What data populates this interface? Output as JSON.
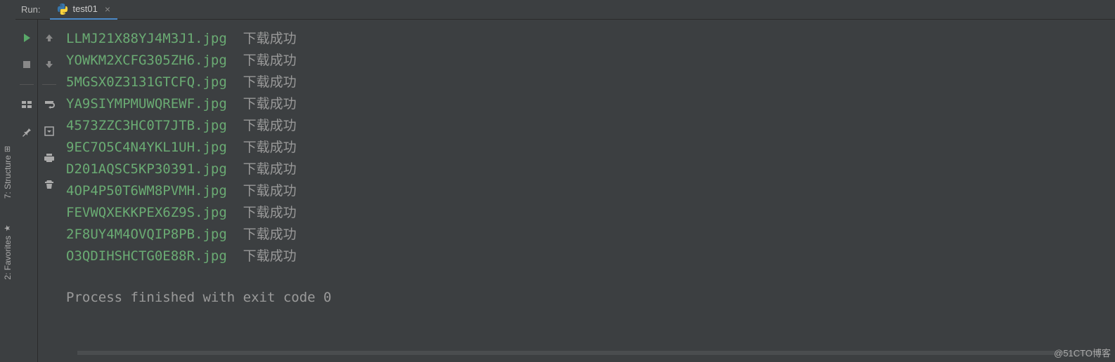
{
  "header": {
    "run_label": "Run:",
    "tab_name": "test01"
  },
  "sidebar_tabs": {
    "structure": "7: Structure",
    "favorites": "2: Favorites"
  },
  "output": {
    "lines": [
      {
        "filename": "LLMJ21X88YJ4M3J1.jpg",
        "status": "下载成功"
      },
      {
        "filename": "YOWKM2XCFG305ZH6.jpg",
        "status": "下载成功"
      },
      {
        "filename": "5MGSX0Z3131GTCFQ.jpg",
        "status": "下载成功"
      },
      {
        "filename": "YA9SIYMPMUWQREWF.jpg",
        "status": "下载成功"
      },
      {
        "filename": "4573ZZC3HC0T7JTB.jpg",
        "status": "下载成功"
      },
      {
        "filename": "9EC7O5C4N4YKL1UH.jpg",
        "status": "下载成功"
      },
      {
        "filename": "D201AQSC5KP30391.jpg",
        "status": "下载成功"
      },
      {
        "filename": "4OP4P50T6WM8PVMH.jpg",
        "status": "下载成功"
      },
      {
        "filename": "FEVWQXEKKPEX6Z9S.jpg",
        "status": "下载成功"
      },
      {
        "filename": "2F8UY4M4OVQIP8PB.jpg",
        "status": "下载成功"
      },
      {
        "filename": "O3QDIHSHCTG0E88R.jpg",
        "status": "下载成功"
      }
    ],
    "exit_message": "Process finished with exit code 0"
  },
  "watermark": "@51CTO博客"
}
